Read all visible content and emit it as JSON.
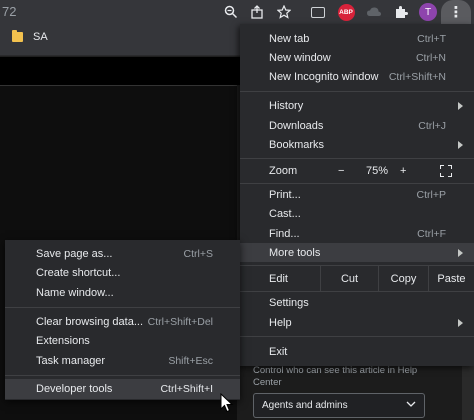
{
  "toolbar": {
    "url_fragment": "72",
    "icons": [
      "zoom-icon",
      "share-icon",
      "star-icon",
      "chat-extension-icon",
      "adblock-plus-icon",
      "cloud-extension-icon",
      "puzzle-icon"
    ],
    "abp_label": "ABP",
    "avatar_letter": "T",
    "kebab_glyph": "⋮"
  },
  "bookmarks": {
    "items": [
      {
        "label": "SA"
      }
    ]
  },
  "page": {
    "help_text": "Control who can see this article in Help Center",
    "select_value": "Agents and admins"
  },
  "main_menu": {
    "new_tab": {
      "label": "New tab",
      "shortcut": "Ctrl+T"
    },
    "new_window": {
      "label": "New window",
      "shortcut": "Ctrl+N"
    },
    "new_incognito": {
      "label": "New Incognito window",
      "shortcut": "Ctrl+Shift+N"
    },
    "history": {
      "label": "History"
    },
    "downloads": {
      "label": "Downloads",
      "shortcut": "Ctrl+J"
    },
    "bookmarks": {
      "label": "Bookmarks"
    },
    "zoom": {
      "label": "Zoom",
      "minus": "−",
      "value": "75%",
      "plus": "+"
    },
    "print": {
      "label": "Print...",
      "shortcut": "Ctrl+P"
    },
    "cast": {
      "label": "Cast..."
    },
    "find": {
      "label": "Find...",
      "shortcut": "Ctrl+F"
    },
    "more_tools": {
      "label": "More tools"
    },
    "edit": {
      "label": "Edit",
      "cut": "Cut",
      "copy": "Copy",
      "paste": "Paste"
    },
    "settings": {
      "label": "Settings"
    },
    "help": {
      "label": "Help"
    },
    "exit": {
      "label": "Exit"
    }
  },
  "sub_menu": {
    "save_page": {
      "label": "Save page as...",
      "shortcut": "Ctrl+S"
    },
    "create_shortcut": {
      "label": "Create shortcut..."
    },
    "name_window": {
      "label": "Name window..."
    },
    "clear_browsing": {
      "label": "Clear browsing data...",
      "shortcut": "Ctrl+Shift+Del"
    },
    "extensions": {
      "label": "Extensions"
    },
    "task_manager": {
      "label": "Task manager",
      "shortcut": "Shift+Esc"
    },
    "developer_tools": {
      "label": "Developer tools",
      "shortcut": "Ctrl+Shift+I"
    }
  },
  "colors": {
    "menu_bg": "#292a2d",
    "highlight": "#3c3d41",
    "toolbar_bg": "#35363a",
    "avatar": "#8e44ad",
    "abp_red": "#d8223a",
    "folder_yellow": "#f2c14e"
  }
}
